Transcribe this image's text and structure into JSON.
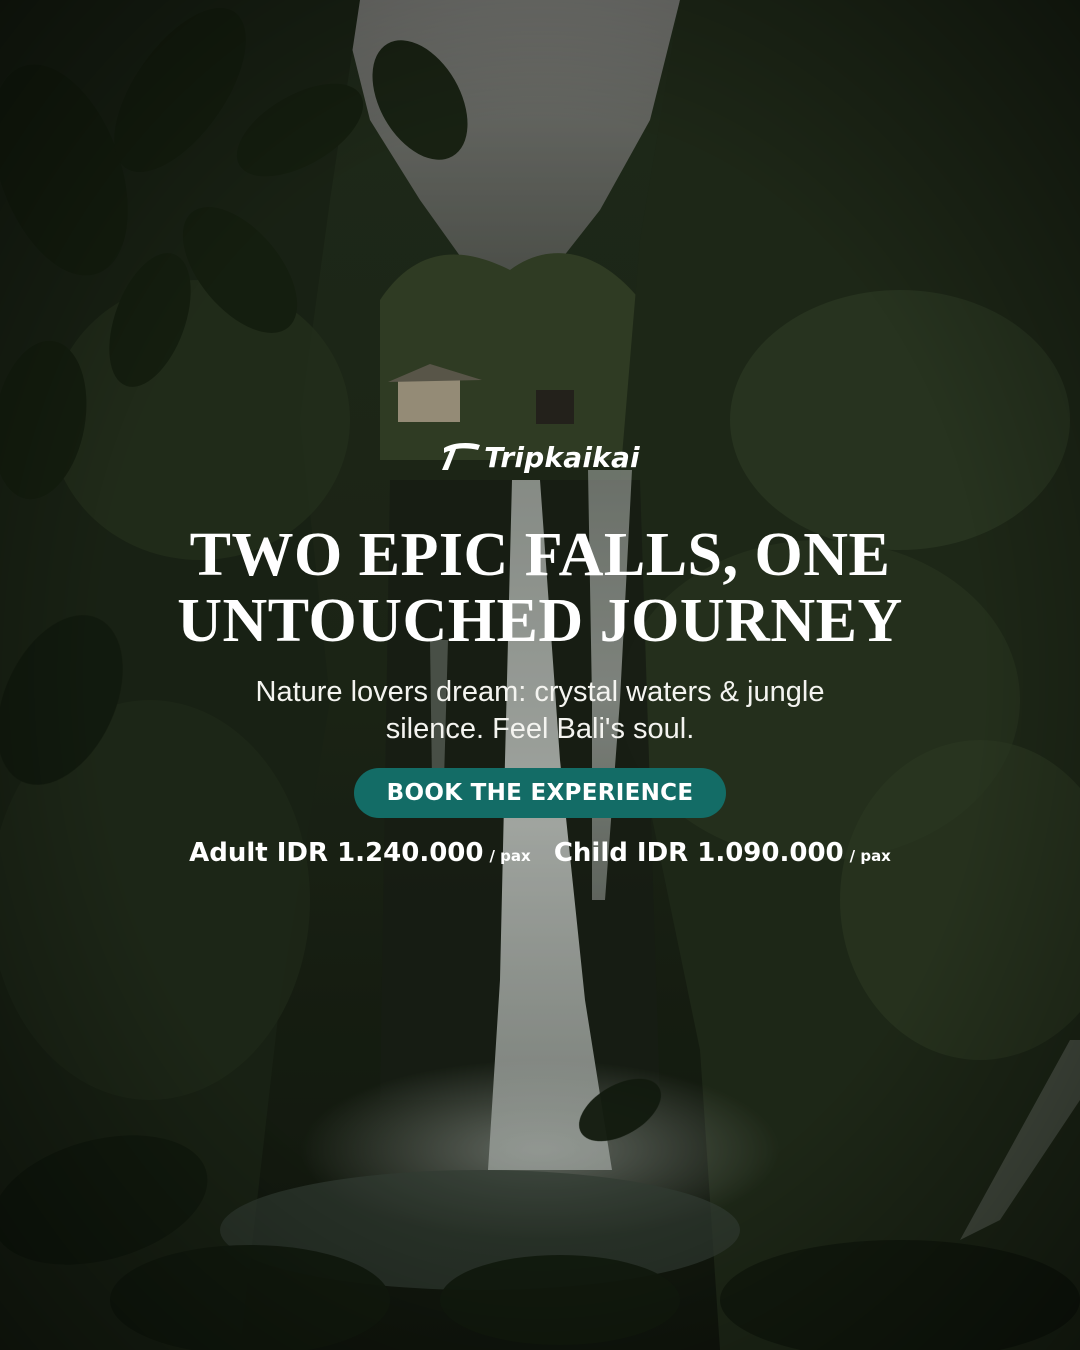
{
  "brand": {
    "name": "Tripkaikai",
    "logo_icon": "stylized-t-swoosh-icon"
  },
  "hero": {
    "headline_line1": "TWO EPIC FALLS, ONE",
    "headline_line2": "UNTOUCHED JOURNEY",
    "subtitle_line1": "Nature lovers dream: crystal waters & jungle",
    "subtitle_line2": "silence. Feel Bali's soul.",
    "background": "jungle waterfall photo"
  },
  "cta": {
    "label": "BOOK THE EXPERIENCE",
    "color": "#136c66"
  },
  "pricing": {
    "adult_label": "Adult IDR 1.240.000",
    "adult_unit": "/ pax",
    "child_label": "Child IDR 1.090.000",
    "child_unit": "/ pax"
  },
  "colors": {
    "text": "#ffffff",
    "accent": "#136c66",
    "foliage_dark": "#1a2415",
    "sky": "#8b8c86"
  }
}
